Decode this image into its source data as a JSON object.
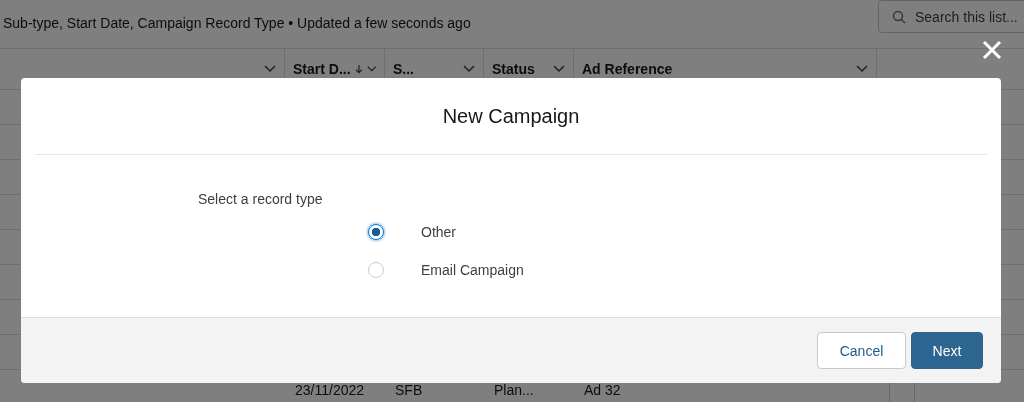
{
  "list_header": {
    "subtitle": "Sub-type, Start Date, Campaign Record Type • Updated a few seconds ago",
    "search": {
      "placeholder": "Search this list..."
    }
  },
  "table": {
    "columns": [
      {
        "sorted": false
      },
      {
        "label": "Start D...",
        "sorted": true
      },
      {
        "label": "S...",
        "sorted": false
      },
      {
        "label": "Status",
        "sorted": false
      },
      {
        "label": "Ad Reference",
        "sorted": false
      }
    ],
    "rows": [
      {
        "cells": [
          "",
          "23/11/2022",
          "SFB",
          "Plan...",
          "Ad 32"
        ]
      }
    ]
  },
  "modal": {
    "title": "New Campaign",
    "prompt": "Select a record type",
    "options": [
      {
        "label": "Other",
        "selected": true
      },
      {
        "label": "Email Campaign",
        "selected": false
      }
    ],
    "buttons": [
      {
        "label": "Cancel",
        "kind": "neutral"
      },
      {
        "label": "Next",
        "kind": "brand"
      }
    ]
  }
}
